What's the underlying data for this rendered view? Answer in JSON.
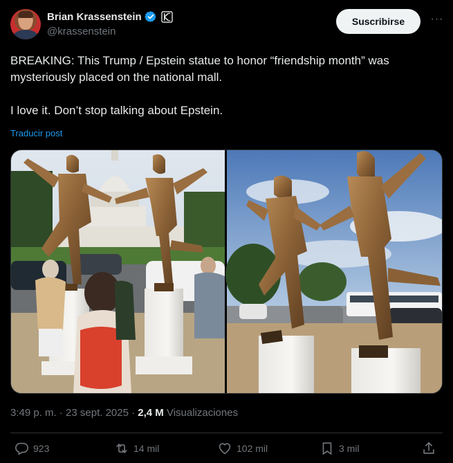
{
  "author": {
    "name": "Brian Krassenstein",
    "handle": "@krassenstein"
  },
  "subscribe_label": "Suscribirse",
  "more_label": "···",
  "post": {
    "paragraph1": "BREAKING: This Trump / Epstein statue to honor “friendship month” was mysteriously placed on the national mall.",
    "paragraph2": "I love it. Don’t stop talking about Epstein."
  },
  "translate_label": "Traducir post",
  "meta": {
    "time_date": "3:49 p. m. · 23 sept. 2025 · ",
    "views_count": "2,4 M",
    "views_label": " Visualizaciones"
  },
  "actions": {
    "replies": "923",
    "reposts": "14 mil",
    "likes": "102 mil",
    "bookmarks": "3 mil"
  },
  "colors": {
    "background": "#000000",
    "link": "#1d9bf0",
    "muted": "#71767b",
    "verified": "#1d9bf0"
  },
  "icons": [
    "verified-badge-icon",
    "affiliate-k-icon",
    "more-icon",
    "reply-icon",
    "repost-icon",
    "like-icon",
    "bookmark-icon",
    "share-icon"
  ]
}
